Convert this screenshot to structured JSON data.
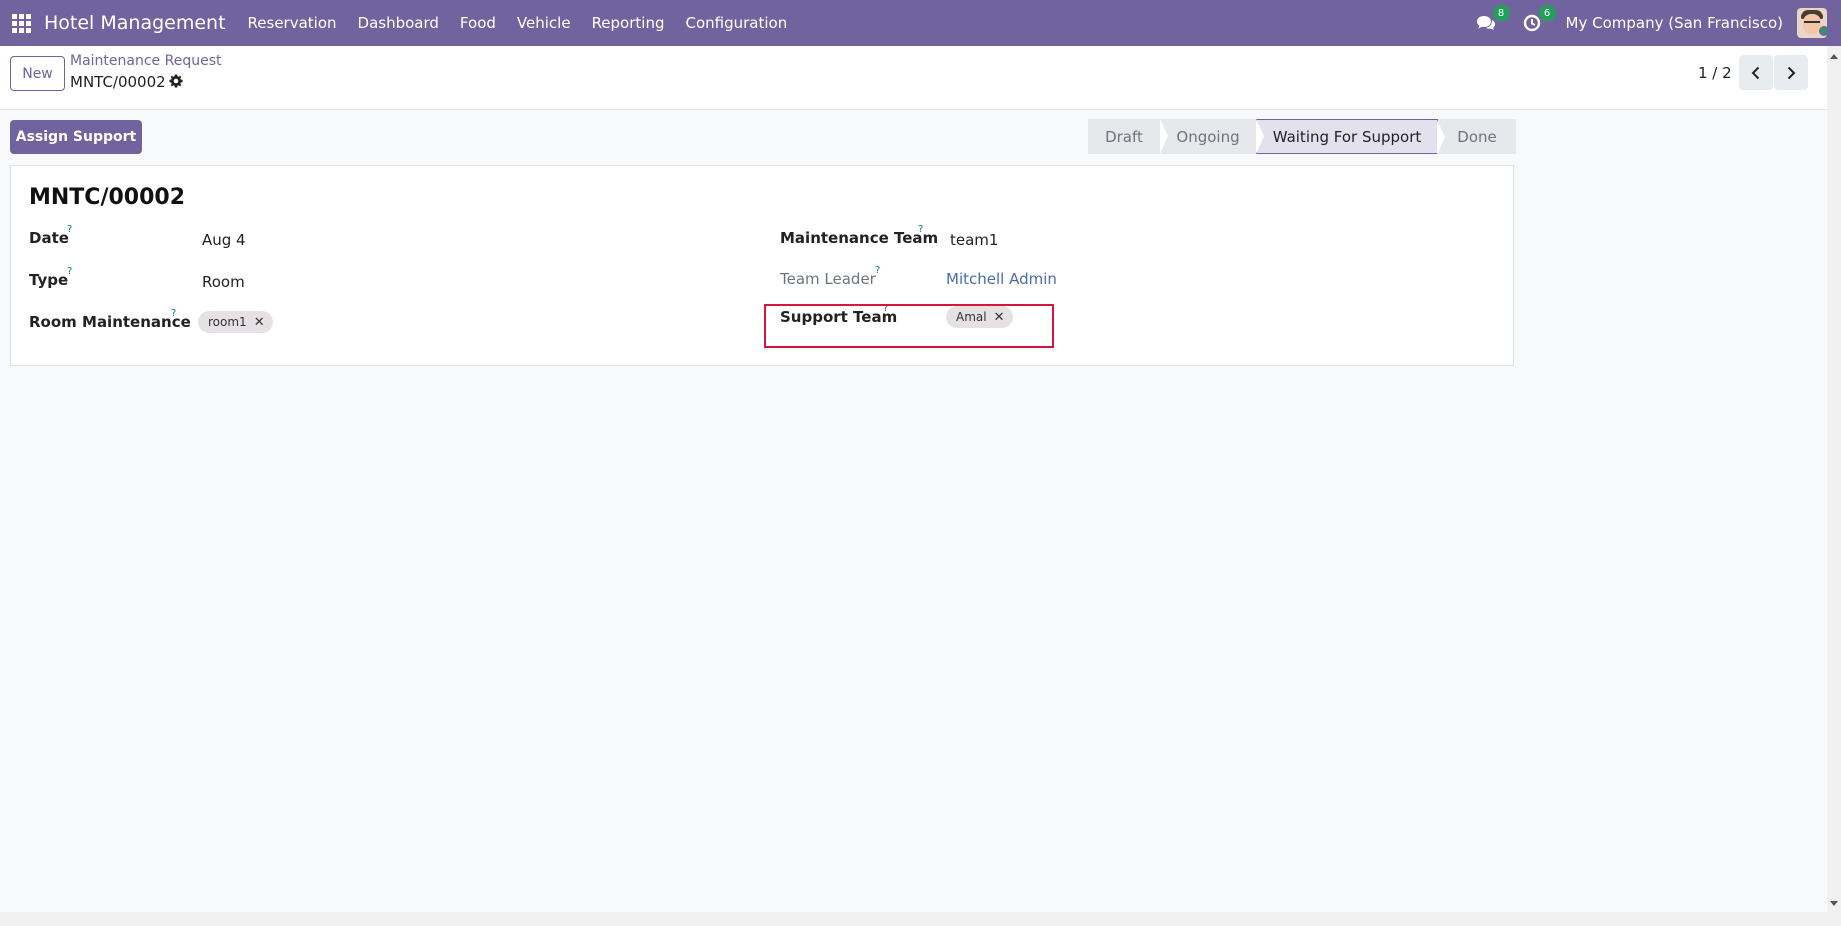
{
  "navbar": {
    "brand": "Hotel Management",
    "menu": [
      "Reservation",
      "Dashboard",
      "Food",
      "Vehicle",
      "Reporting",
      "Configuration"
    ],
    "messages_count": "8",
    "activities_count": "6",
    "company": "My Company (San Francisco)"
  },
  "control_panel": {
    "new_label": "New",
    "breadcrumb": "Maintenance Request",
    "record_name": "MNTC/00002",
    "pager": "1 / 2"
  },
  "statusbar": {
    "action_label": "Assign Support",
    "stages": [
      "Draft",
      "Ongoing",
      "Waiting For Support",
      "Done"
    ],
    "active_stage": "Waiting For Support"
  },
  "form": {
    "title": "MNTC/00002",
    "date_label": "Date",
    "date_value": "Aug 4",
    "type_label": "Type",
    "type_value": "Room",
    "room_maintenance_label": "Room Maintenance",
    "room_maintenance_tag": "room1",
    "maintenance_team_label": "Maintenance Team",
    "maintenance_team_value": "team1",
    "team_leader_label": "Team Leader",
    "team_leader_value": "Mitchell Admin",
    "support_team_label": "Support Team",
    "support_team_tag": "Amal",
    "help_mark": "?",
    "remove_mark": "✕"
  },
  "colors": {
    "brand": "#71639e",
    "badge": "#22a05a",
    "highlight": "#d6173b"
  }
}
